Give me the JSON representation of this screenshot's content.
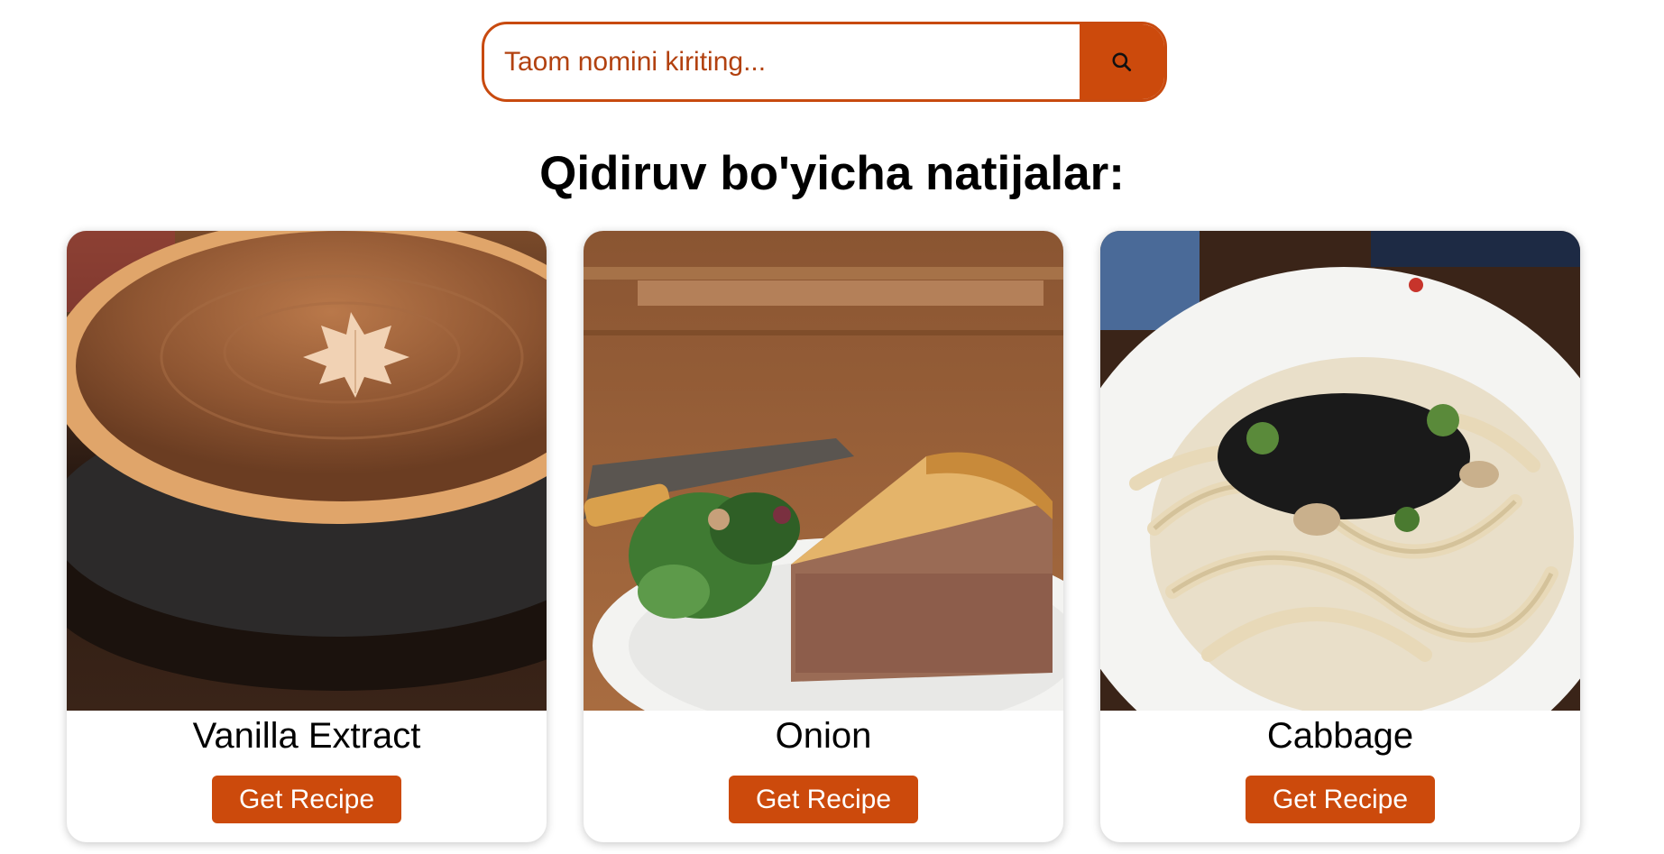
{
  "search": {
    "placeholder": "Taom nomini kiriting...",
    "button_icon": "search-icon"
  },
  "results": {
    "title": "Qidiruv bo'yicha natijalar:"
  },
  "cards": [
    {
      "name": "Vanilla Extract",
      "button_label": "Get Recipe",
      "image": "pumpkin-pie-photo"
    },
    {
      "name": "Onion",
      "button_label": "Get Recipe",
      "image": "meat-pie-slice-photo"
    },
    {
      "name": "Cabbage",
      "button_label": "Get Recipe",
      "image": "udon-noodles-photo"
    }
  ],
  "colors": {
    "accent": "#cc4a0c",
    "placeholder": "#b2410f"
  }
}
